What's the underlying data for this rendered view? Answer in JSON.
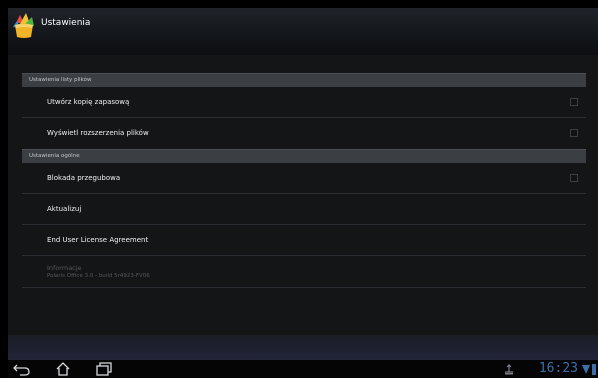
{
  "titlebar": {
    "title": "Ustawienia",
    "app_icon": "polaris-office-icon"
  },
  "sections": [
    {
      "header": "Ustawienia listy plików",
      "items": [
        {
          "label": "Utwórz kopię zapasową",
          "checked": false
        },
        {
          "label": "Wyświetl rozszerzenia plików",
          "checked": false
        }
      ]
    },
    {
      "header": "Ustawienia ogólne",
      "items": [
        {
          "label": "Blokada przegubowa",
          "checked": false
        },
        {
          "label": "Aktualizuj"
        },
        {
          "label": "End User License Agreement"
        },
        {
          "label": "Informacje",
          "sublabel": "Polaris Office 3.0 - build 5r4923-FV06"
        }
      ]
    }
  ],
  "statusbar": {
    "time": "16:23"
  },
  "colors": {
    "accent": "#3c6faa",
    "section_header": "#3b3e42"
  },
  "icons": [
    "back-icon",
    "home-icon",
    "recent-apps-icon",
    "usb-icon",
    "wifi-icon",
    "battery-icon"
  ]
}
